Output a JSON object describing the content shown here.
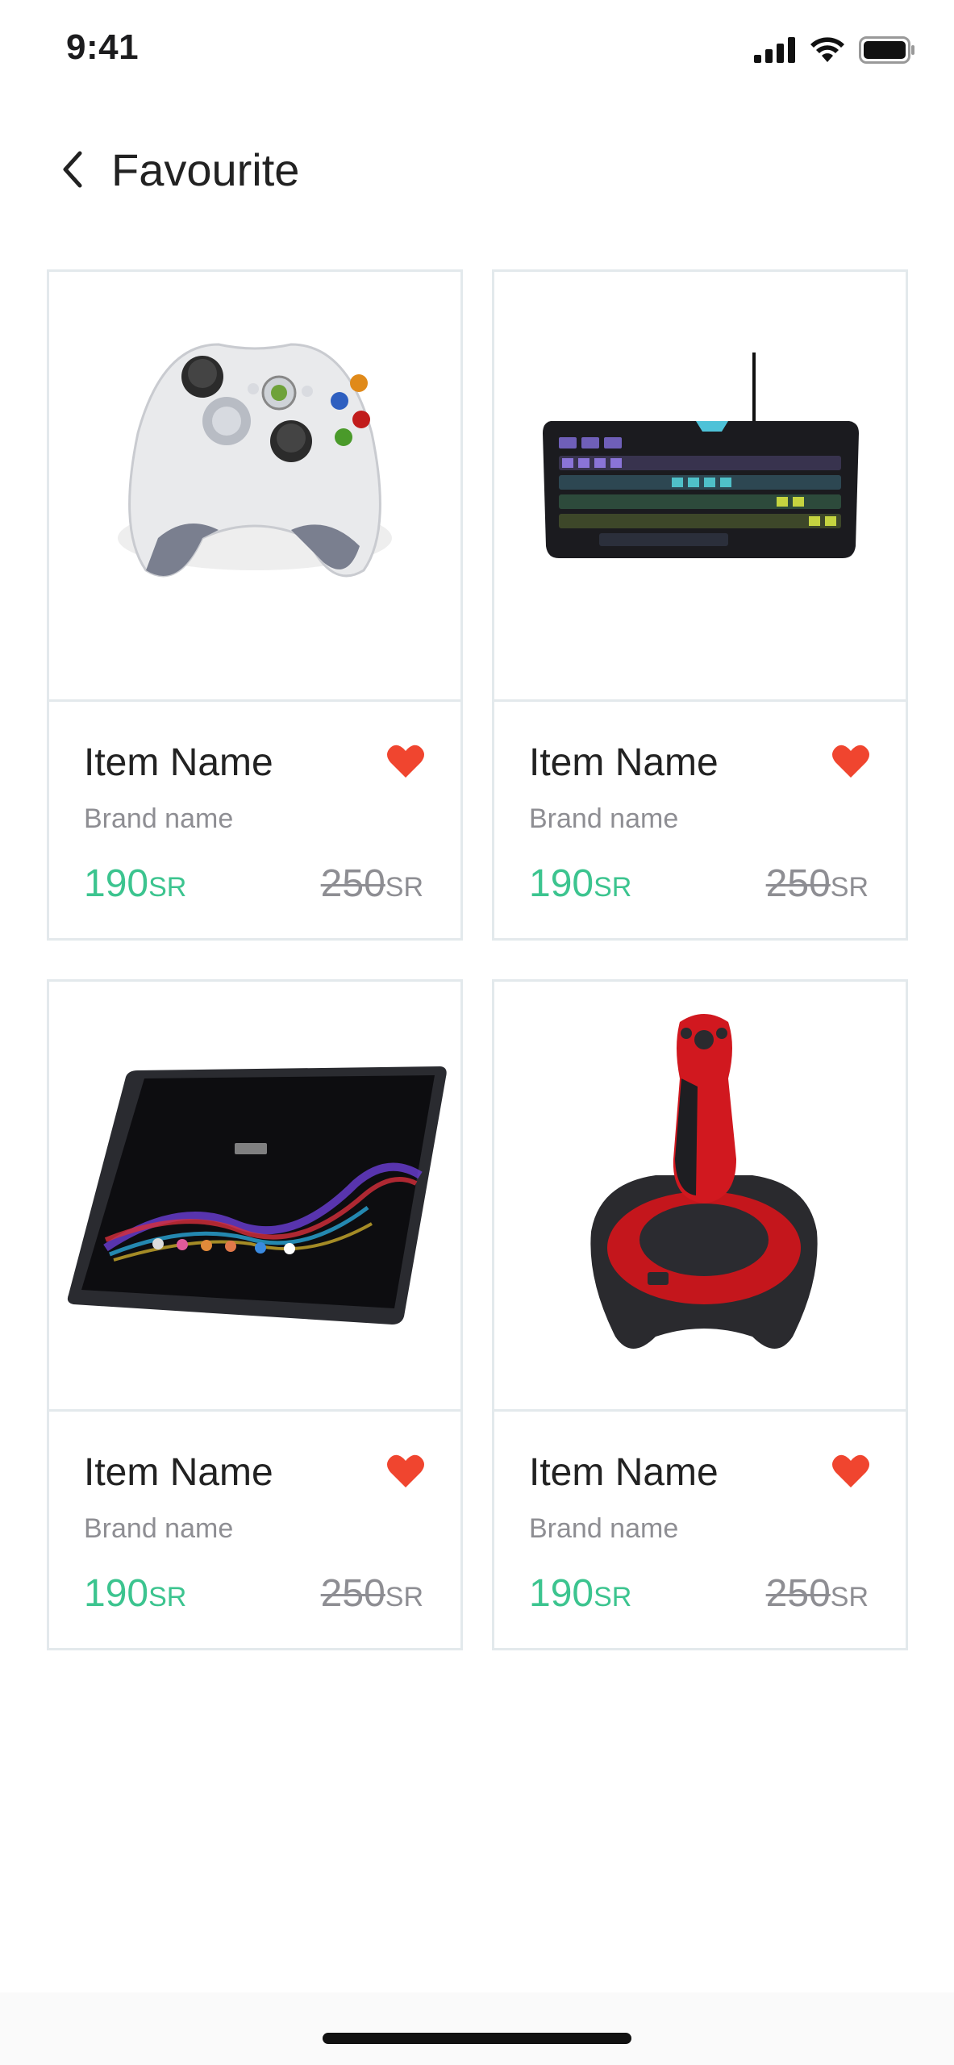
{
  "status_bar": {
    "time": "9:41"
  },
  "header": {
    "title": "Favourite"
  },
  "items": [
    {
      "name": "Item Name",
      "brand": "Brand name",
      "price": "190",
      "price_currency": "SR",
      "old_price": "250",
      "old_price_currency": "SR",
      "image": "game-controller",
      "favourite": true
    },
    {
      "name": "Item Name",
      "brand": "Brand name",
      "price": "190",
      "price_currency": "SR",
      "old_price": "250",
      "old_price_currency": "SR",
      "image": "gaming-keyboard",
      "favourite": true
    },
    {
      "name": "Item Name",
      "brand": "Brand name",
      "price": "190",
      "price_currency": "SR",
      "old_price": "250",
      "old_price_currency": "SR",
      "image": "tablet",
      "favourite": true
    },
    {
      "name": "Item Name",
      "brand": "Brand name",
      "price": "190",
      "price_currency": "SR",
      "old_price": "250",
      "old_price_currency": "SR",
      "image": "joystick",
      "favourite": true
    }
  ],
  "colors": {
    "price": "#3cc48f",
    "heart": "#f0452f",
    "border": "#e3e9ec"
  }
}
